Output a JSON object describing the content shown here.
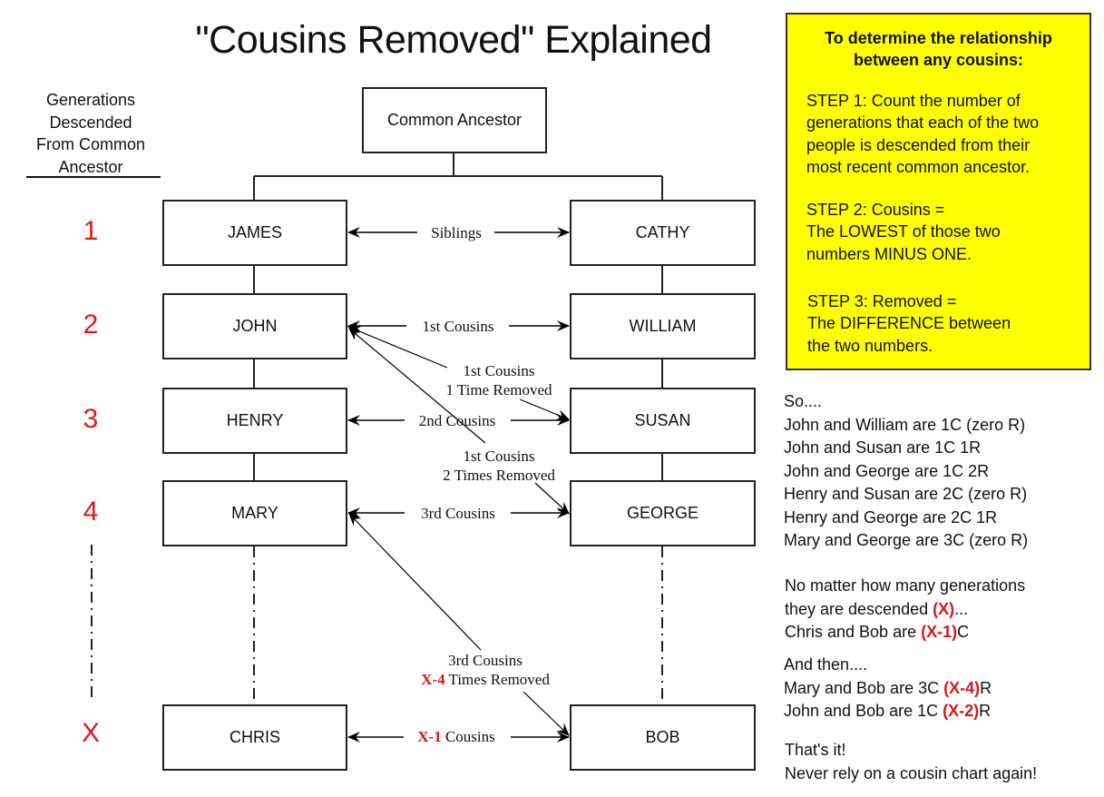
{
  "title": "\"Cousins Removed\" Explained",
  "generations_header": [
    "Generations",
    "Descended",
    "From Common",
    "Ancestor"
  ],
  "generation_numbers": [
    "1",
    "2",
    "3",
    "4",
    "X"
  ],
  "common_ancestor": "Common Ancestor",
  "left_lineage": [
    "JAMES",
    "JOHN",
    "HENRY",
    "MARY",
    "CHRIS"
  ],
  "right_lineage": [
    "CATHY",
    "WILLIAM",
    "SUSAN",
    "GEORGE",
    "BOB"
  ],
  "relationships": {
    "siblings": "Siblings",
    "first_cousins": "1st Cousins",
    "second_cousins": "2nd Cousins",
    "third_cousins": "3rd Cousins",
    "x_cousins": {
      "red": "X-1",
      "text": "Cousins"
    },
    "first_1r": [
      "1st Cousins",
      "1 Time Removed"
    ],
    "first_2r": [
      "1st Cousins",
      "2 Times Removed"
    ],
    "third_xr": {
      "line1": "3rd Cousins",
      "red": "X-4",
      "text": "Times Removed"
    }
  },
  "rules": {
    "heading": [
      "To determine the relationship",
      "between any cousins:"
    ],
    "step1": [
      "STEP 1: Count the number of",
      "generations that each of the two",
      "people is descended from their",
      "most recent common ancestor."
    ],
    "step2": [
      "STEP 2: Cousins =",
      "The LOWEST of those two",
      "numbers MINUS ONE."
    ],
    "step3": [
      "STEP 3: Removed =",
      "The DIFFERENCE between",
      "the two numbers."
    ]
  },
  "examples": {
    "intro": "So....",
    "lines": [
      "John and William are 1C  (zero R)",
      "John and Susan are 1C 1R",
      "John and George are 1C 2R",
      "Henry and Susan are 2C  (zero R)",
      "Henry and George are 2C 1R",
      "Mary and George are 3C  (zero R)"
    ]
  },
  "general": {
    "line1": "No matter how many generations",
    "line2_pre": "they are descended ",
    "line2_red": "(X)",
    "line2_post": "...",
    "line3_pre": "Chris and Bob are ",
    "line3_red": "(X-1)",
    "line3_post": "C"
  },
  "then": {
    "intro": "And then....",
    "l1_pre": "Mary and Bob are 3C ",
    "l1_red": "(X-4)",
    "l1_post": "R",
    "l2_pre": "John and Bob are 1C ",
    "l2_red": "(X-2)",
    "l2_post": "R"
  },
  "closing": [
    "That's it!",
    "Never rely on a cousin chart again!"
  ],
  "colors": {
    "highlight": "#ffff00",
    "accent_red": "#e01818"
  }
}
